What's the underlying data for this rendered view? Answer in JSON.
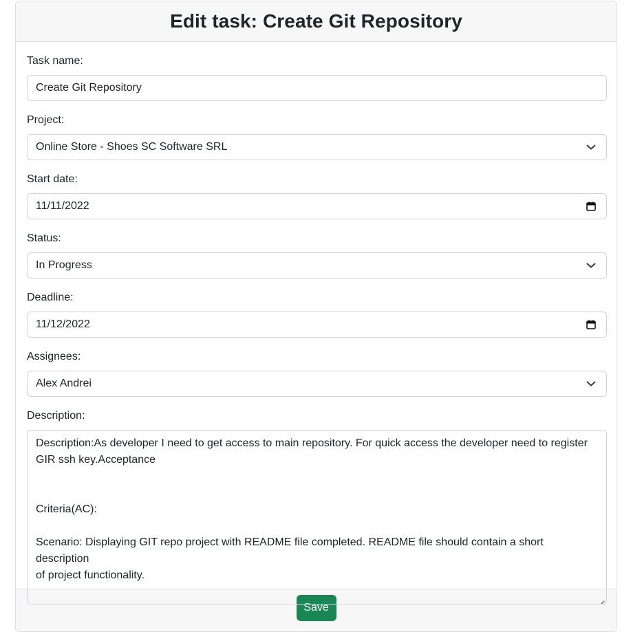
{
  "header": {
    "title": "Edit task: Create Git Repository"
  },
  "form": {
    "task_name": {
      "label": "Task name:",
      "value": "Create Git Repository"
    },
    "project": {
      "label": "Project:",
      "value": "Online Store - Shoes SC Software SRL",
      "icon": "chevron-down-icon"
    },
    "start_date": {
      "label": "Start date:",
      "value": "11/11/2022",
      "icon": "calendar-icon"
    },
    "status": {
      "label": "Status:",
      "value": "In Progress",
      "icon": "chevron-down-icon"
    },
    "deadline": {
      "label": "Deadline:",
      "value": "11/12/2022",
      "icon": "calendar-icon"
    },
    "assignees": {
      "label": "Assignees:",
      "value": "Alex Andrei",
      "icon": "chevron-down-icon"
    },
    "description": {
      "label": "Description:",
      "lines": [
        "Description:As developer I need to get access to main repository. For quick access the developer need to register",
        "GIR ssh key.Acceptance",
        "",
        "",
        "Criteria(AC):",
        "",
        "Scenario: Displaying GIT repo project with README file completed. README file should contain a short description",
        "of project functionality."
      ]
    }
  },
  "footer": {
    "save_label": "Save"
  },
  "colors": {
    "accent_success": "#198754",
    "header_bg": "#f7f7f7",
    "border": "#ced4da"
  }
}
